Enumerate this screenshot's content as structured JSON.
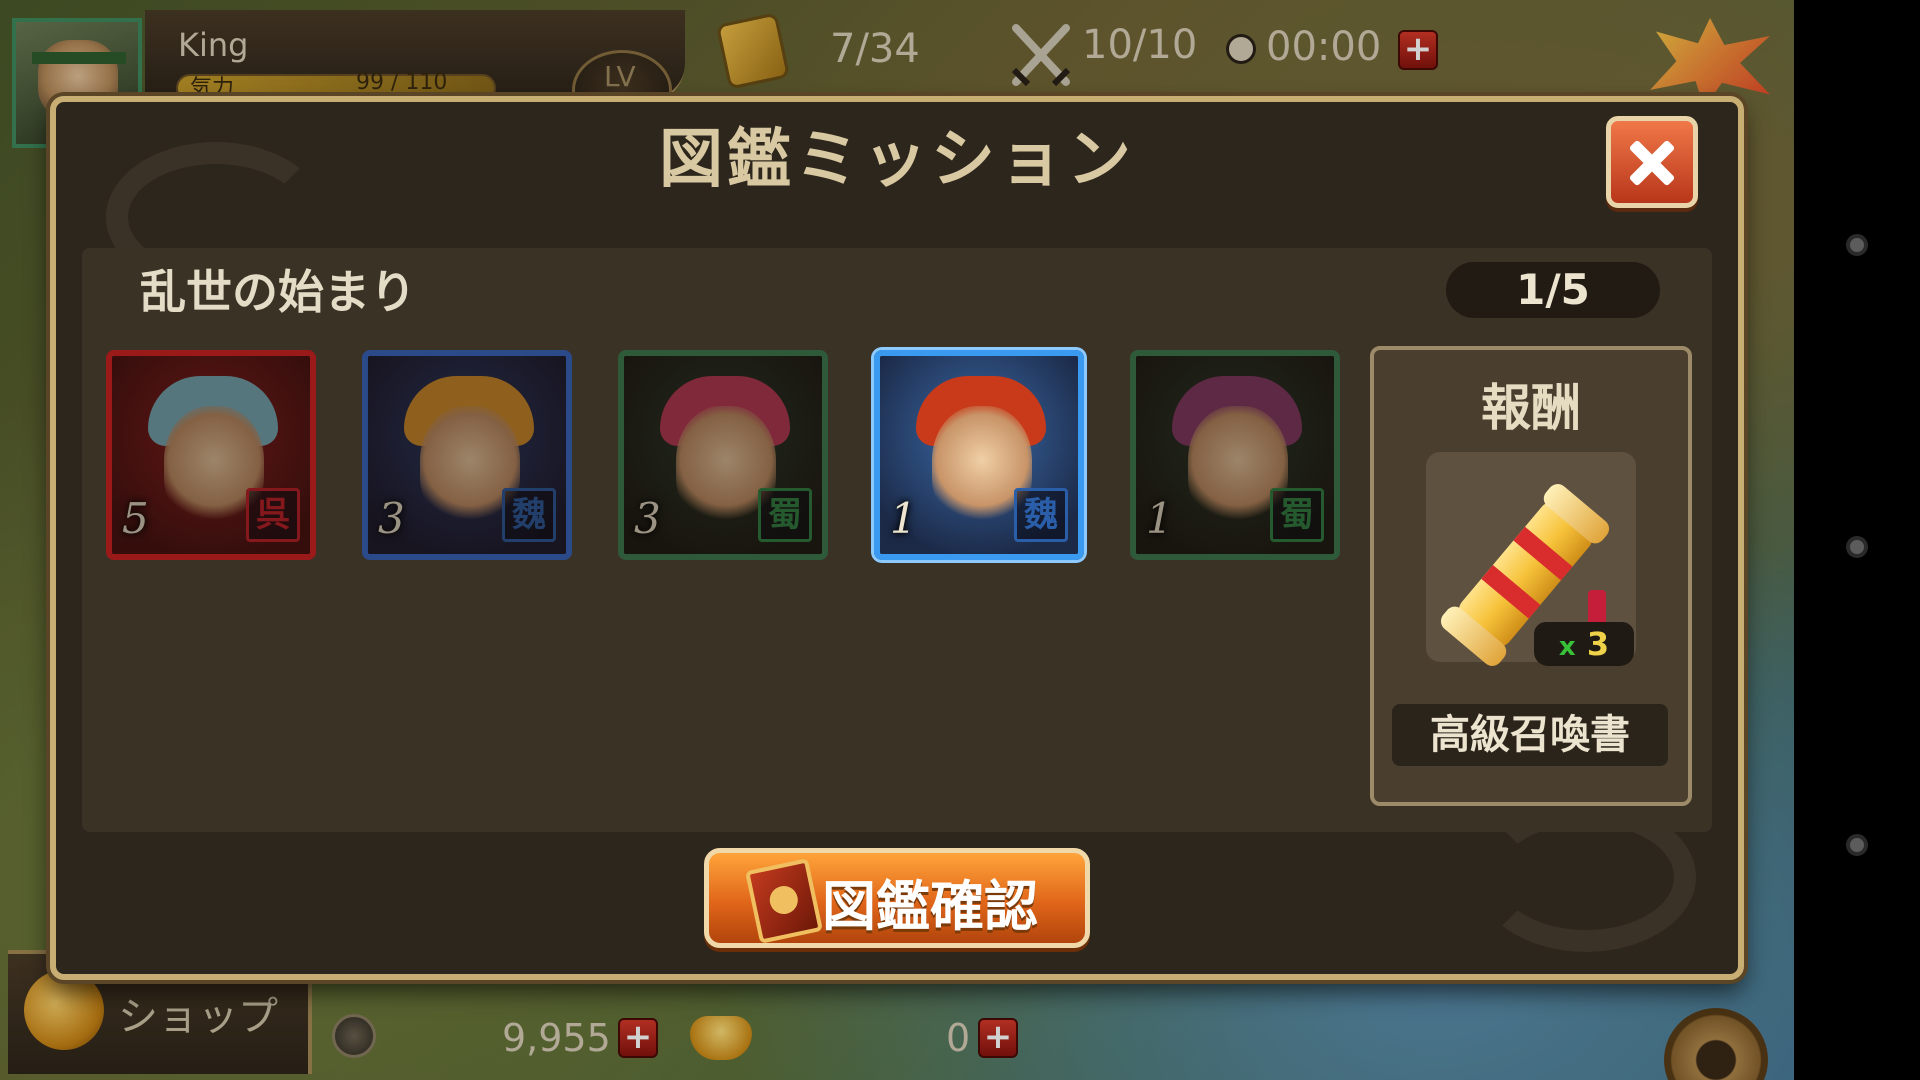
{
  "hud": {
    "player_name": "King",
    "stamina_label": "気力",
    "stamina_value": "99 / 110",
    "lv_label": "LV",
    "inventory_count": "7/34",
    "battle_count": "10/10",
    "timer": "00:00",
    "plus": "+"
  },
  "bottom": {
    "shop_label": "ショップ",
    "coins": "9,955",
    "ingots": "0",
    "plus": "+"
  },
  "dialog": {
    "title": "図鑑ミッション",
    "mission_name": "乱世の始まり",
    "progress": "1/5",
    "heroes": [
      {
        "stars": "5",
        "faction": "呉",
        "faction_color": "#c8202a",
        "highlighted": false
      },
      {
        "stars": "3",
        "faction": "魏",
        "faction_color": "#2a5ea8",
        "highlighted": false
      },
      {
        "stars": "3",
        "faction": "蜀",
        "faction_color": "#2e8a46",
        "highlighted": false
      },
      {
        "stars": "1",
        "faction": "魏",
        "faction_color": "#2a5ea8",
        "highlighted": true
      },
      {
        "stars": "1",
        "faction": "蜀",
        "faction_color": "#2e8a46",
        "highlighted": false
      }
    ],
    "reward": {
      "title": "報酬",
      "qty_x": "x",
      "qty_n": "3",
      "item_name": "高級召喚書",
      "icon": "summon-scroll-icon"
    },
    "confirm_label": "図鑑確認"
  },
  "colors": {
    "accent_orange": "#e0661a",
    "close_red": "#b8361a",
    "frame_gold": "#c9ae74",
    "panel_dark": "#2d261d"
  }
}
